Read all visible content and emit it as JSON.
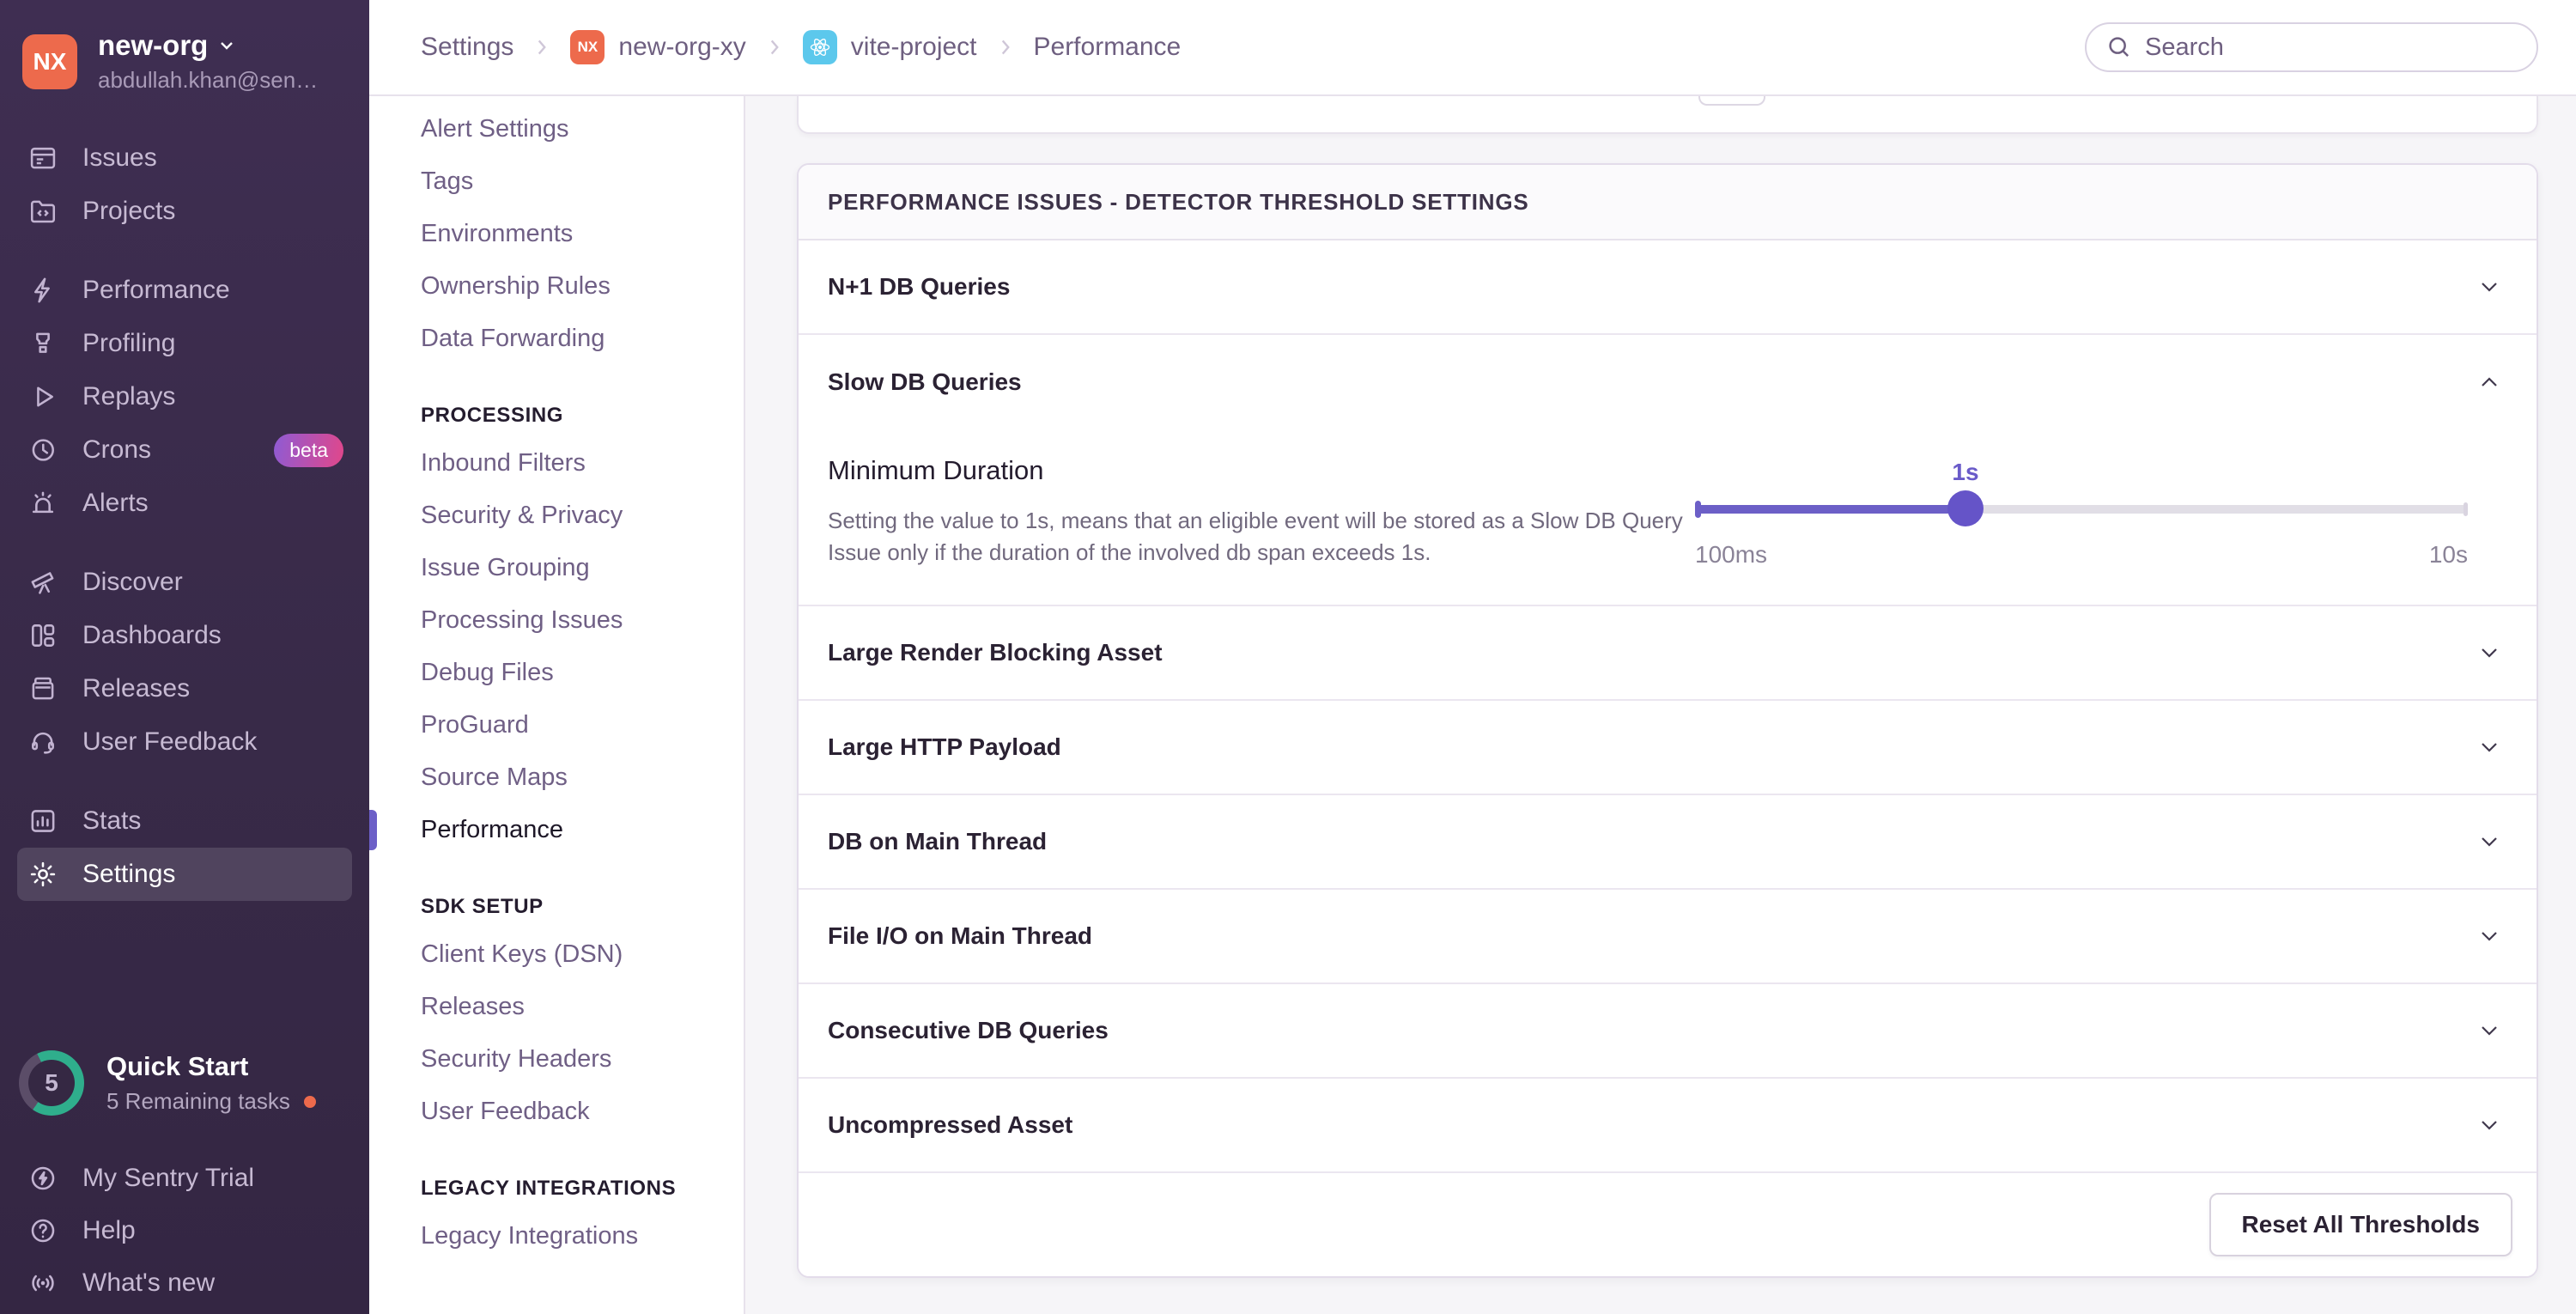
{
  "colors": {
    "accent_purple": "#6c5fc7",
    "sidebar_background": "#3f2e52",
    "org_avatar_orange": "#ed6a4c",
    "quickstart_teal": "#2fae8c",
    "react_icon_cyan": "#5cc8ec",
    "beta_gradient_start": "#8e5bd4",
    "beta_gradient_end": "#e1478a"
  },
  "sidebar": {
    "org": {
      "initials": "NX",
      "name": "new-org",
      "email": "abdullah.khan@sen…"
    },
    "groups": [
      {
        "items": [
          {
            "label": "Issues"
          },
          {
            "label": "Projects"
          }
        ]
      },
      {
        "items": [
          {
            "label": "Performance"
          },
          {
            "label": "Profiling"
          },
          {
            "label": "Replays"
          },
          {
            "label": "Crons",
            "badge": "beta"
          },
          {
            "label": "Alerts"
          }
        ]
      },
      {
        "items": [
          {
            "label": "Discover"
          },
          {
            "label": "Dashboards"
          },
          {
            "label": "Releases"
          },
          {
            "label": "User Feedback"
          }
        ]
      },
      {
        "items": [
          {
            "label": "Stats"
          },
          {
            "label": "Settings",
            "active": true
          }
        ]
      }
    ],
    "quick_start": {
      "count": "5",
      "title": "Quick Start",
      "subtitle": "5 Remaining tasks"
    },
    "footer": [
      {
        "label": "My Sentry Trial"
      },
      {
        "label": "Help"
      },
      {
        "label": "What's new"
      }
    ]
  },
  "topbar": {
    "breadcrumb": [
      {
        "label": "Settings"
      },
      {
        "label": "new-org-xy",
        "avatar": "NX"
      },
      {
        "label": "vite-project"
      },
      {
        "label": "Performance"
      }
    ],
    "search": {
      "placeholder": "Search"
    }
  },
  "settings_nav": {
    "top_items": [
      {
        "label": "Alert Settings"
      },
      {
        "label": "Tags"
      },
      {
        "label": "Environments"
      },
      {
        "label": "Ownership Rules"
      },
      {
        "label": "Data Forwarding"
      }
    ],
    "sections": [
      {
        "header": "PROCESSING",
        "items": [
          {
            "label": "Inbound Filters"
          },
          {
            "label": "Security & Privacy"
          },
          {
            "label": "Issue Grouping"
          },
          {
            "label": "Processing Issues"
          },
          {
            "label": "Debug Files"
          },
          {
            "label": "ProGuard"
          },
          {
            "label": "Source Maps"
          },
          {
            "label": "Performance",
            "active": true
          }
        ]
      },
      {
        "header": "SDK SETUP",
        "items": [
          {
            "label": "Client Keys (DSN)"
          },
          {
            "label": "Releases"
          },
          {
            "label": "Security Headers"
          },
          {
            "label": "User Feedback"
          }
        ]
      },
      {
        "header": "LEGACY INTEGRATIONS",
        "items": [
          {
            "label": "Legacy Integrations"
          }
        ]
      }
    ]
  },
  "main": {
    "panel_title": "PERFORMANCE ISSUES - DETECTOR THRESHOLD SETTINGS",
    "rows": [
      {
        "label": "N+1 DB Queries",
        "expanded": false
      },
      {
        "label": "Slow DB Queries",
        "expanded": true
      },
      {
        "label": "Large Render Blocking Asset",
        "expanded": false
      },
      {
        "label": "Large HTTP Payload",
        "expanded": false
      },
      {
        "label": "DB on Main Thread",
        "expanded": false
      },
      {
        "label": "File I/O on Main Thread",
        "expanded": false
      },
      {
        "label": "Consecutive DB Queries",
        "expanded": false
      },
      {
        "label": "Uncompressed Asset",
        "expanded": false
      }
    ],
    "slow_db_settings": {
      "label": "Minimum Duration",
      "description": "Setting the value to 1s, means that an eligible event will be stored as a Slow DB Query Issue only if the duration of the involved db span exceeds 1s.",
      "slider": {
        "value": "1s",
        "min": "100ms",
        "max": "10s",
        "percent": 35
      }
    },
    "reset_button": "Reset All Thresholds"
  }
}
